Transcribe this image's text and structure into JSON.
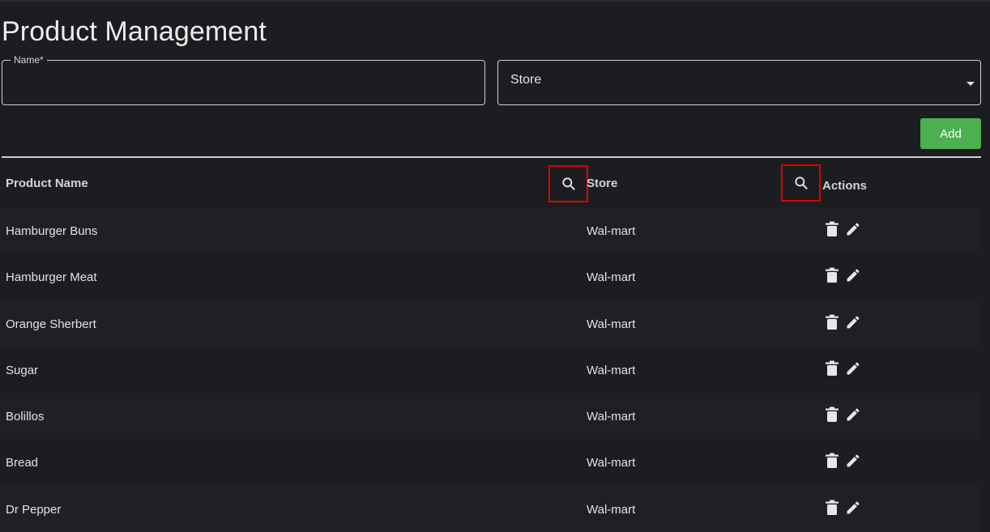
{
  "page": {
    "title": "Product Management"
  },
  "form": {
    "name_label": "Name*",
    "name_value": "",
    "store_value": "Store",
    "add_label": "Add"
  },
  "table": {
    "headers": {
      "product": "Product Name",
      "store": "Store",
      "actions": "Actions"
    },
    "rows": [
      {
        "product": "Hamburger Buns",
        "store": "Wal-mart"
      },
      {
        "product": "Hamburger Meat",
        "store": "Wal-mart"
      },
      {
        "product": "Orange Sherbert",
        "store": "Wal-mart"
      },
      {
        "product": "Sugar",
        "store": "Wal-mart"
      },
      {
        "product": "Bolillos",
        "store": "Wal-mart"
      },
      {
        "product": "Bread",
        "store": "Wal-mart"
      },
      {
        "product": "Dr Pepper",
        "store": "Wal-mart"
      }
    ]
  },
  "icons": {
    "column_search": "search-icon",
    "delete": "trash-icon",
    "edit": "pencil-icon",
    "store_dropdown": "caret-down-icon"
  },
  "colors": {
    "background": "#1c1d20",
    "accent_button": "#4caf50",
    "highlight_box": "#e00000"
  }
}
